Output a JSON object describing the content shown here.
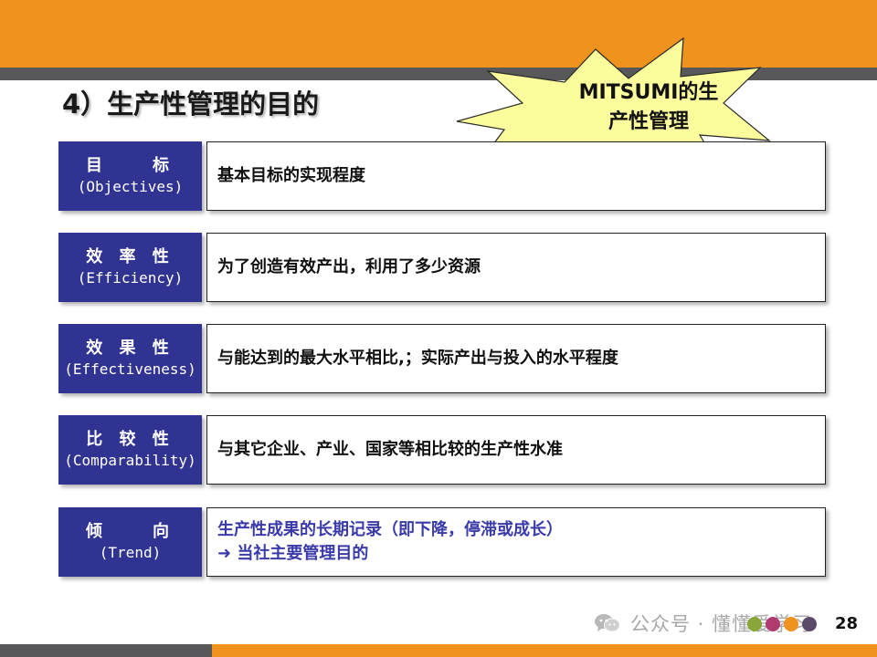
{
  "slide": {
    "title": "4）生产性管理的目的",
    "burst_text": [
      "MITSUMI的生",
      "产性管理"
    ],
    "rows": [
      {
        "label_zh": "目    标",
        "label_en": "(Objectives)",
        "lines": [
          "基本目标的实现程度"
        ],
        "blue": false
      },
      {
        "label_zh": "效 率 性",
        "label_en": "(Efficiency)",
        "lines": [
          "为了创造有效产出，利用了多少资源"
        ],
        "blue": false
      },
      {
        "label_zh": "效 果 性",
        "label_en": "(Effectiveness)",
        "lines": [
          "与能达到的最大水平相比,；实际产出与投入的水平程度"
        ],
        "blue": false
      },
      {
        "label_zh": "比 较 性",
        "label_en": "(Comparability)",
        "lines": [
          "与其它企业、产业、国家等相比较的生产性水准"
        ],
        "blue": false
      },
      {
        "label_zh": "倾    向",
        "label_en": "(Trend)",
        "lines": [
          "生产性成果的长期记录（即下降，停滞或成长）",
          "➜ 当社主要管理目的"
        ],
        "blue": true
      }
    ]
  },
  "footer": {
    "watermark": "公众号 · 懂懂爱学习",
    "page_number": "28"
  },
  "colors": {
    "orange": "#f0921e",
    "gray_stripe": "#58585a",
    "label_blue": "#313392",
    "burst_fill": "#fbfc9c",
    "text_blue": "#3a3aa8",
    "dots": [
      "#8aa63a",
      "#b13a6e",
      "#f0921e",
      "#5a4a6a"
    ]
  },
  "icons": {
    "burst": "starburst-shape",
    "wechat": "wechat-icon"
  }
}
